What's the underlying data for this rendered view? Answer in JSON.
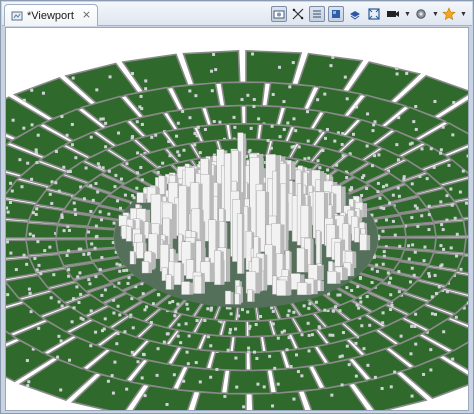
{
  "window": {
    "tab": {
      "title": "*Viewport",
      "close_glyph": "⨯",
      "icon": "viewport-icon"
    },
    "toolbar": [
      {
        "name": "camera-reset-icon",
        "pressed": true
      },
      {
        "name": "selection-tool-icon",
        "pressed": false
      },
      {
        "name": "wireframe-toggle-icon",
        "pressed": true
      },
      {
        "name": "shaded-mode-icon",
        "pressed": true
      },
      {
        "name": "layers-icon",
        "pressed": false
      },
      {
        "name": "frame-all-icon",
        "pressed": false
      },
      {
        "name": "camera-bookmark-icon",
        "pressed": false,
        "dropdown": true
      },
      {
        "name": "settings-gear-icon",
        "pressed": false,
        "dropdown": true
      },
      {
        "name": "star-bookmark-icon",
        "pressed": false,
        "dropdown": true
      }
    ]
  },
  "scene": {
    "description_colors": {
      "ground": "#2f6a2c",
      "road": "#8a8a8a",
      "building_light": "#f2f2f2",
      "building_shade": "#b9b9b9",
      "background": "#ffffff"
    }
  }
}
